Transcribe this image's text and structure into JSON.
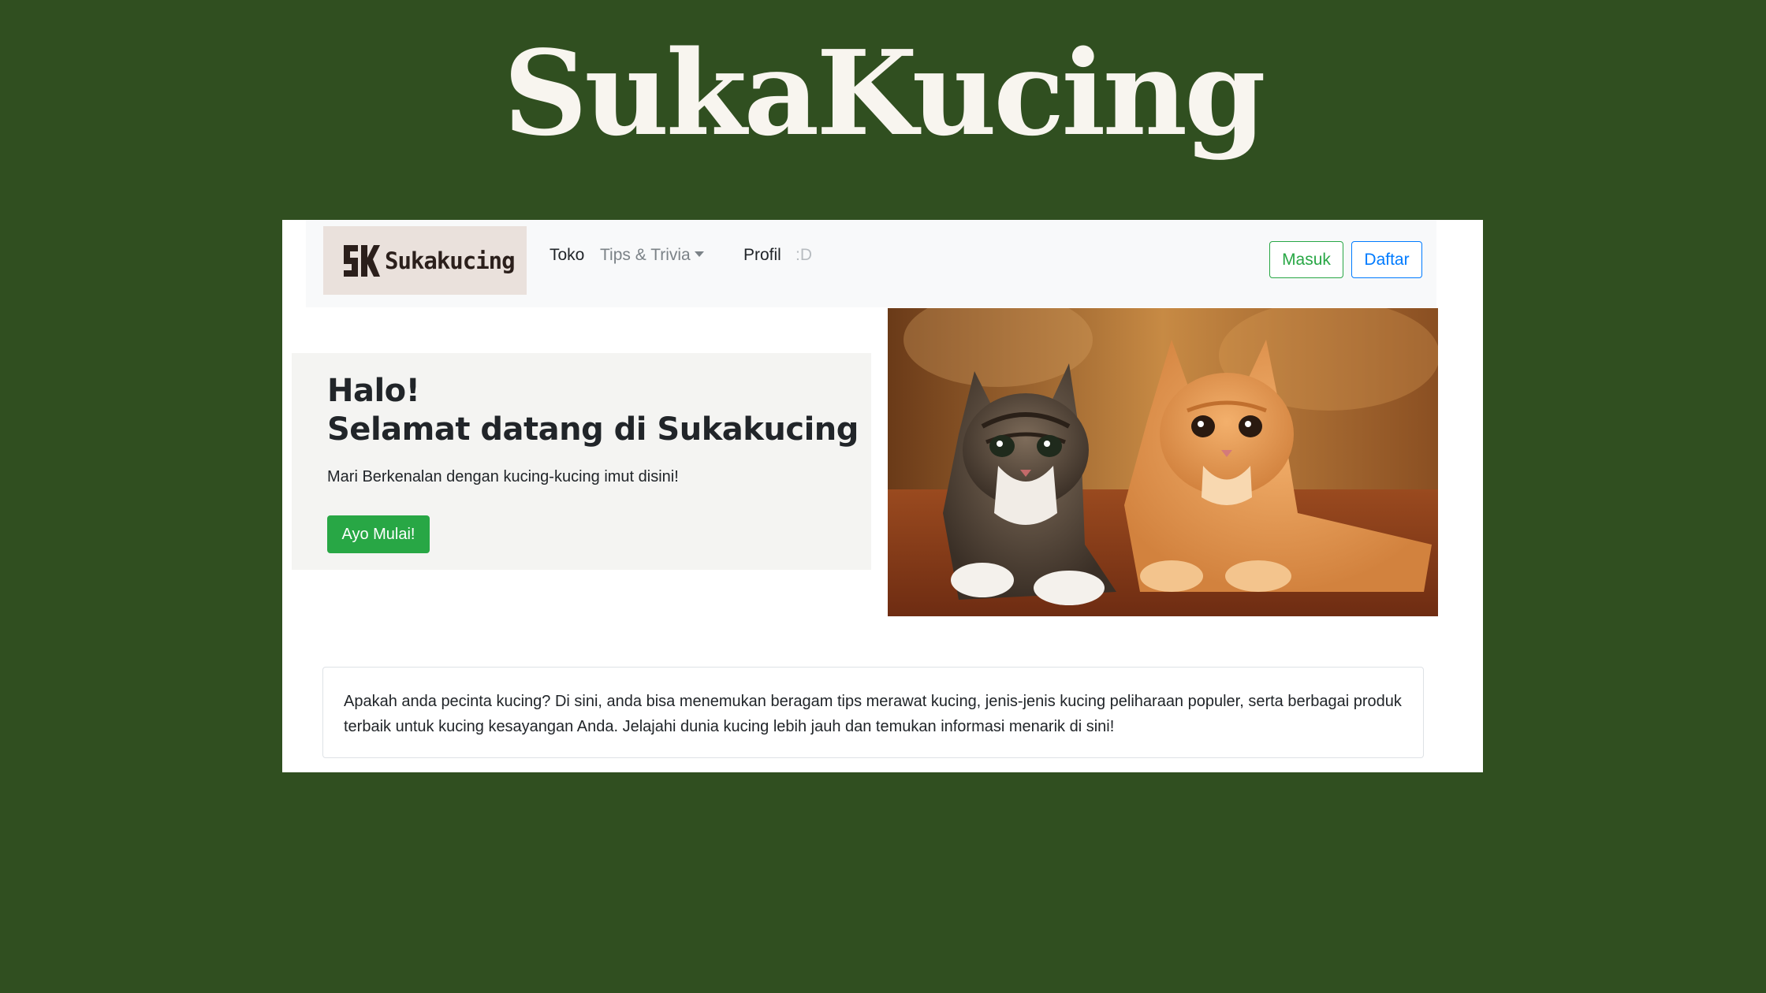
{
  "banner": {
    "title": "SukaKucing"
  },
  "navbar": {
    "brand_text": "Sukakucing",
    "brand_mark": "SK",
    "links": {
      "toko": "Toko",
      "tips": "Tips & Trivia",
      "profil": "Profil",
      "smile": ":D"
    },
    "login_label": "Masuk",
    "register_label": "Daftar"
  },
  "hero": {
    "title_line1": "Halo!",
    "title_line2": "Selamat datang di Sukakucing",
    "subtitle": "Mari Berkenalan dengan kucing-kucing imut disini!",
    "cta_label": "Ayo Mulai!"
  },
  "description": "Apakah anda pecinta kucing? Di sini, anda bisa menemukan beragam tips merawat kucing, jenis-jenis kucing peliharaan populer, serta berbagai produk terbaik untuk kucing kesayangan Anda. Jelajahi dunia kucing lebih jauh dan temukan informasi menarik di sini!",
  "colors": {
    "background": "#304f20",
    "success": "#28a745",
    "primary": "#007bff"
  }
}
